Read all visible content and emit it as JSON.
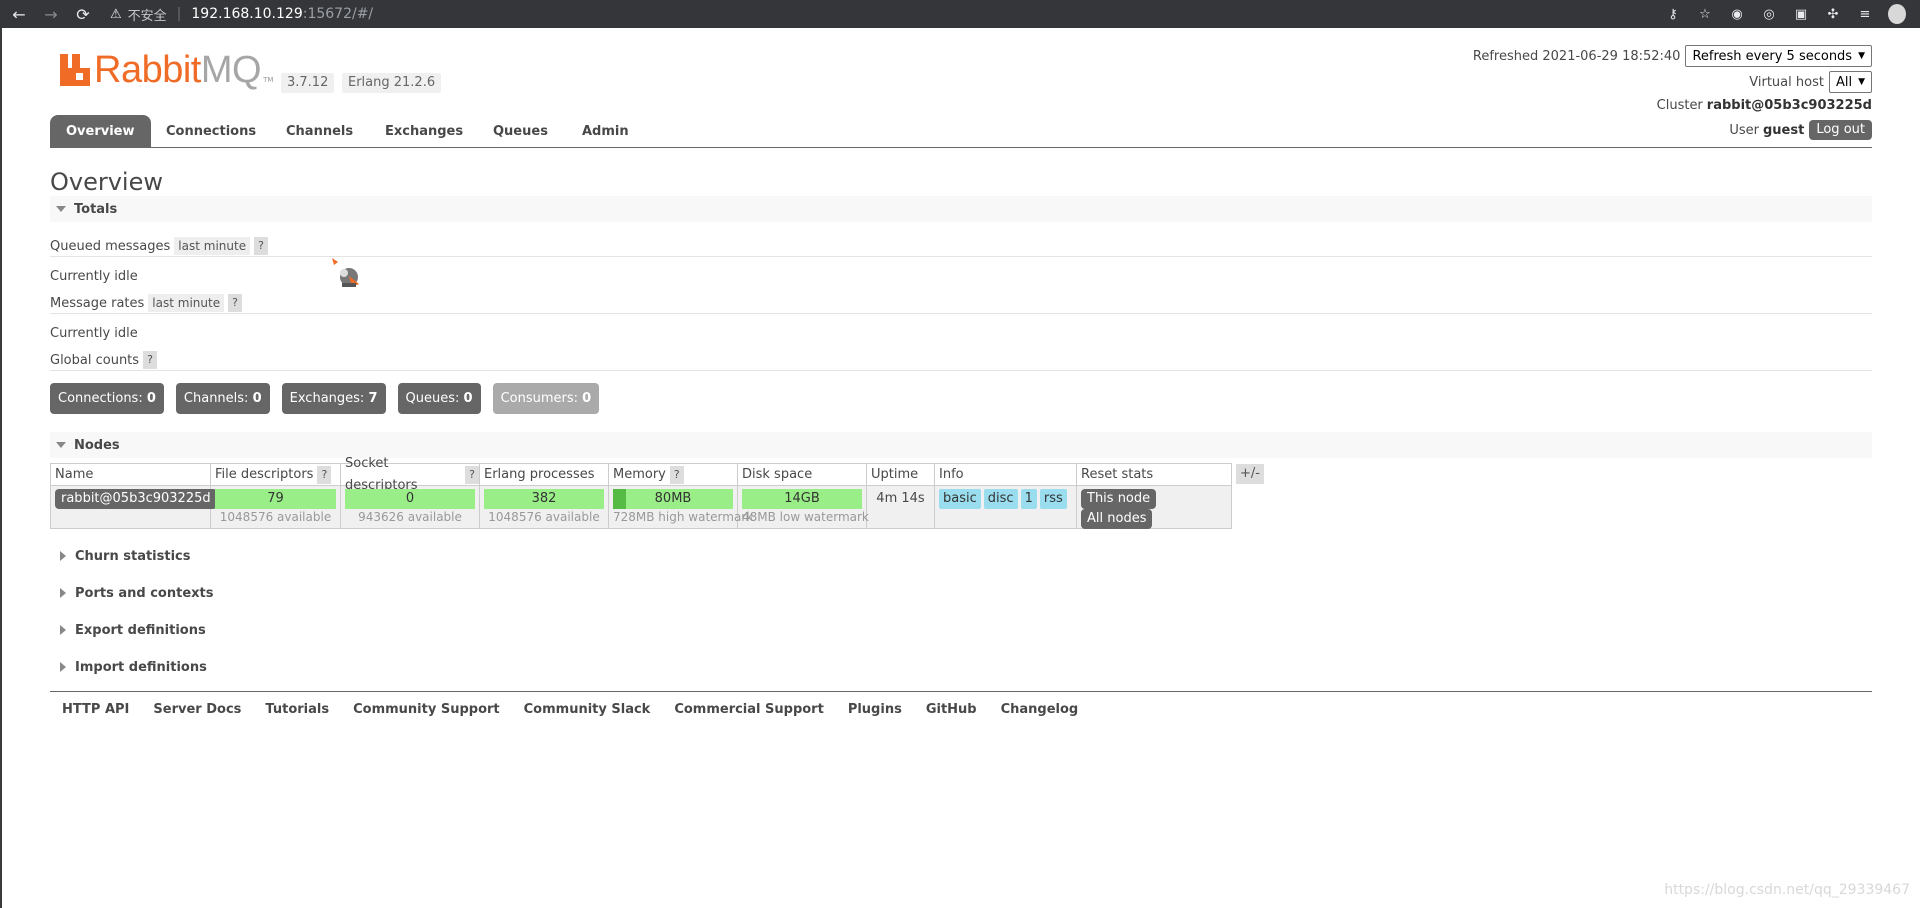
{
  "browser": {
    "insecure_label": "不安全",
    "host": "192.168.10.129",
    "path": ":15672/#/"
  },
  "header": {
    "logo_rabbit": "Rabbit",
    "logo_mq": "MQ",
    "logo_tm": "TM",
    "version": "3.7.12",
    "erlang": "Erlang 21.2.6",
    "refreshed_label": "Refreshed 2021-06-29 18:52:40",
    "refresh_select": "Refresh every 5 seconds",
    "vhost_label": "Virtual host",
    "vhost_select": "All",
    "cluster_label": "Cluster",
    "cluster_name": "rabbit@05b3c903225d",
    "user_label": "User",
    "user_name": "guest",
    "logout": "Log out"
  },
  "tabs": [
    {
      "label": "Overview"
    },
    {
      "label": "Connections"
    },
    {
      "label": "Channels"
    },
    {
      "label": "Exchanges"
    },
    {
      "label": "Queues"
    },
    {
      "label": "Admin"
    }
  ],
  "main": {
    "title": "Overview",
    "totals": {
      "title": "Totals",
      "queued_label": "Queued messages",
      "queued_range": "last minute",
      "help": "?",
      "queued_status": "Currently idle",
      "rates_label": "Message rates",
      "rates_range": "last minute",
      "rates_status": "Currently idle",
      "global_label": "Global counts"
    },
    "counts": [
      {
        "label": "Connections:",
        "value": "0"
      },
      {
        "label": "Channels:",
        "value": "0"
      },
      {
        "label": "Exchanges:",
        "value": "7"
      },
      {
        "label": "Queues:",
        "value": "0"
      },
      {
        "label": "Consumers:",
        "value": "0"
      }
    ],
    "nodes": {
      "title": "Nodes",
      "headers": [
        "Name",
        "File descriptors",
        "Socket descriptors",
        "Erlang processes",
        "Memory",
        "Disk space",
        "Uptime",
        "Info",
        "Reset stats"
      ],
      "plusminus": "+/-",
      "row": {
        "name": "rabbit@05b3c903225d",
        "file_desc": "79",
        "file_desc_avail": "1048576 available",
        "socket_desc": "0",
        "socket_desc_avail": "943626 available",
        "erlang_proc": "382",
        "erlang_proc_avail": "1048576 available",
        "memory": "80MB",
        "memory_fill": 0.11,
        "memory_sub": "728MB high watermark",
        "disk": "14GB",
        "disk_sub": "48MB low watermark",
        "uptime": "4m 14s",
        "info": [
          "basic",
          "disc",
          "1",
          "rss"
        ],
        "reset": [
          "This node",
          "All nodes"
        ]
      }
    },
    "collapsed_sections": [
      "Churn statistics",
      "Ports and contexts",
      "Export definitions",
      "Import definitions"
    ]
  },
  "footer": {
    "links": [
      "HTTP API",
      "Server Docs",
      "Tutorials",
      "Community Support",
      "Community Slack",
      "Commercial Support",
      "Plugins",
      "GitHub",
      "Changelog"
    ]
  },
  "watermark": "https://blog.csdn.net/qq_29339467",
  "colors": {
    "brand_orange": "#f06b26",
    "tab_active": "#666666",
    "bar_green": "#99ee88",
    "info_blue": "#99ddee"
  }
}
